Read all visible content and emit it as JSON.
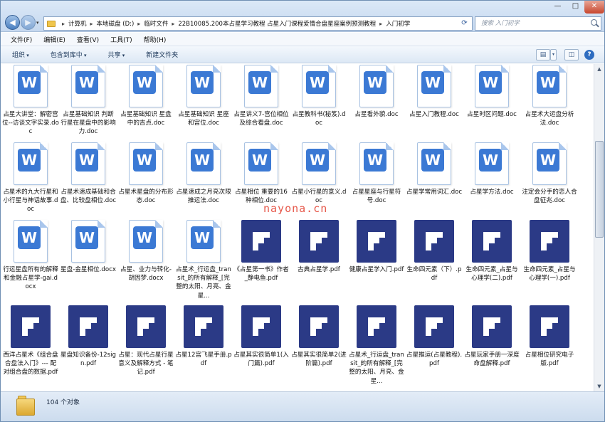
{
  "window": {
    "controls": [
      "—",
      "□",
      "✕"
    ]
  },
  "address": {
    "crumbs": [
      "计算机",
      "本地磁盘 (D:)",
      "临时文件",
      "22B10085.200本占星学习教程 占星入门课程爱情合盘星座案例预测教程",
      "入门初学"
    ],
    "search_placeholder": "搜索 入门初学"
  },
  "menu": [
    "文件(F)",
    "编辑(E)",
    "查看(V)",
    "工具(T)",
    "帮助(H)"
  ],
  "toolbar": {
    "organize": "组织",
    "include": "包含到库中",
    "share": "共享",
    "new_folder": "新建文件夹"
  },
  "files": [
    {
      "name": "占星大讲堂：解密宫位--访谈文字实录.doc",
      "type": "doc"
    },
    {
      "name": "占星基础知识 判断行星在星盘中的影响力.doc",
      "type": "doc"
    },
    {
      "name": "占星基础知识 星盘中的吉点.doc",
      "type": "doc"
    },
    {
      "name": "占星基础知识 星座和宫位.doc",
      "type": "doc"
    },
    {
      "name": "占星讲义7-宫位相位及综合看盘.doc",
      "type": "doc"
    },
    {
      "name": "占星教科书(秘笈).doc",
      "type": "doc"
    },
    {
      "name": "占星看外貌.doc",
      "type": "doc"
    },
    {
      "name": "占星入门教程.doc",
      "type": "doc"
    },
    {
      "name": "占星时区问题.doc",
      "type": "doc"
    },
    {
      "name": "占星术大运盘分析法.doc",
      "type": "doc"
    },
    {
      "name": "占星术的九大行星和小行星与神话故事.doc",
      "type": "doc"
    },
    {
      "name": "占星术速成基础和合盘、比较盘相位.doc",
      "type": "doc"
    },
    {
      "name": "占星术星盘的分布形态.doc",
      "type": "doc"
    },
    {
      "name": "占星速成之月亮次限推运法.doc",
      "type": "doc"
    },
    {
      "name": "占星相位 重要的16种相位.doc",
      "type": "doc"
    },
    {
      "name": "占星小行星的意义.doc",
      "type": "doc"
    },
    {
      "name": "占星星座与行星符号.doc",
      "type": "doc"
    },
    {
      "name": "占星学常用词汇.doc",
      "type": "doc"
    },
    {
      "name": "占星学方法.doc",
      "type": "doc"
    },
    {
      "name": "注定会分手的恋人合盘征兆.doc",
      "type": "doc"
    },
    {
      "name": "行运星盘所有的解释和金融占星学-gai.docx",
      "type": "doc"
    },
    {
      "name": "星盘-金星相位.docx",
      "type": "doc"
    },
    {
      "name": "占星、业力与转化-胡因梦.docx",
      "type": "doc"
    },
    {
      "name": "占星术_行运盘_transit_的所有解释_[完整的太阳、月亮、金星...",
      "type": "doc"
    },
    {
      "name": "《占星第一书》作者_静电鱼.pdf",
      "type": "pdf"
    },
    {
      "name": "古典占星学.pdf",
      "type": "pdf"
    },
    {
      "name": "健康占星学入门.pdf",
      "type": "pdf"
    },
    {
      "name": "生命四元素（下）.pdf",
      "type": "pdf"
    },
    {
      "name": "生命四元素_占星与心理学(二).pdf",
      "type": "pdf"
    },
    {
      "name": "生命四元素_占星与心理学(一).pdf",
      "type": "pdf"
    },
    {
      "name": "西洋占星术《组合盘合盘法入门》--- 配对组合盘的数据.pdf",
      "type": "pdf"
    },
    {
      "name": "星盘知识备份-12sign.pdf",
      "type": "pdf"
    },
    {
      "name": "占星：现代占星行星意义及解释方式 - 笔记.pdf",
      "type": "pdf"
    },
    {
      "name": "占星12宫飞星手册.pdf",
      "type": "pdf"
    },
    {
      "name": "占星其实很简单1(入门篇).pdf",
      "type": "pdf"
    },
    {
      "name": "占星其实很简单2(进阶篇).pdf",
      "type": "pdf"
    },
    {
      "name": "占星术_行运盘_transit_的所有解释_[完整的太阳、月亮、金星...",
      "type": "pdf"
    },
    {
      "name": "占星推运(占星教程).pdf",
      "type": "pdf"
    },
    {
      "name": "占星玩家手册一深度命盘解释.pdf",
      "type": "pdf"
    },
    {
      "name": "占星相位研究电子版.pdf",
      "type": "pdf"
    }
  ],
  "doc_icon_letter": "W",
  "status": {
    "count": "104 个对象"
  },
  "watermark": "nayona.cn",
  "colors": {
    "doc_icon": "#3b79d4",
    "pdf_icon": "#2b3a86",
    "watermark": "#e23a2a"
  }
}
